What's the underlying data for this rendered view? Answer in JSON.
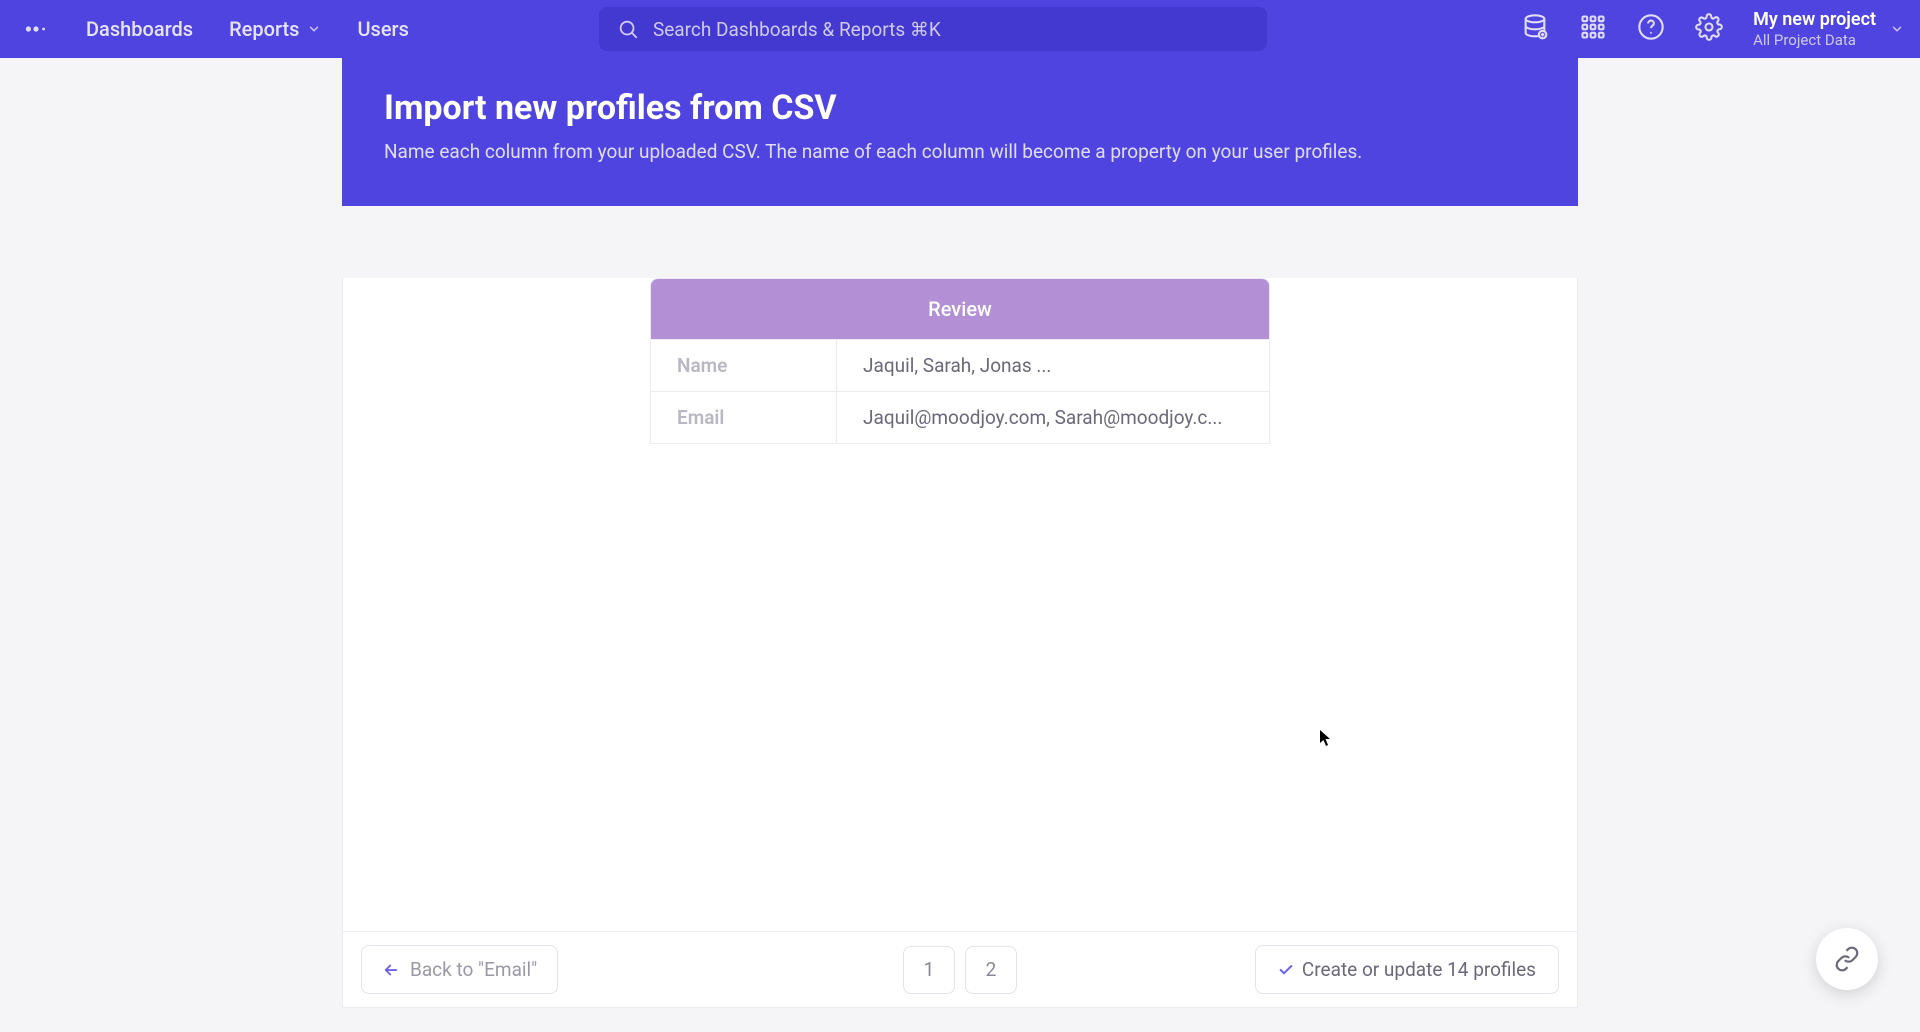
{
  "nav": {
    "dashboards": "Dashboards",
    "reports": "Reports",
    "users": "Users"
  },
  "search": {
    "placeholder": "Search Dashboards & Reports ⌘K"
  },
  "project": {
    "title": "My new project",
    "subtitle": "All Project Data"
  },
  "banner": {
    "title": "Import new profiles from CSV",
    "subtitle": "Name each column from your uploaded CSV. The name of each column will become a property on your user profiles."
  },
  "review": {
    "header": "Review",
    "rows": [
      {
        "label": "Name",
        "value": "Jaquil, Sarah, Jonas ..."
      },
      {
        "label": "Email",
        "value": "Jaquil@moodjoy.com, Sarah@moodjoy.c..."
      }
    ]
  },
  "footer": {
    "back_label": "Back to \"Email\"",
    "pages": [
      "1",
      "2"
    ],
    "confirm_label": "Create or update 14 profiles"
  }
}
